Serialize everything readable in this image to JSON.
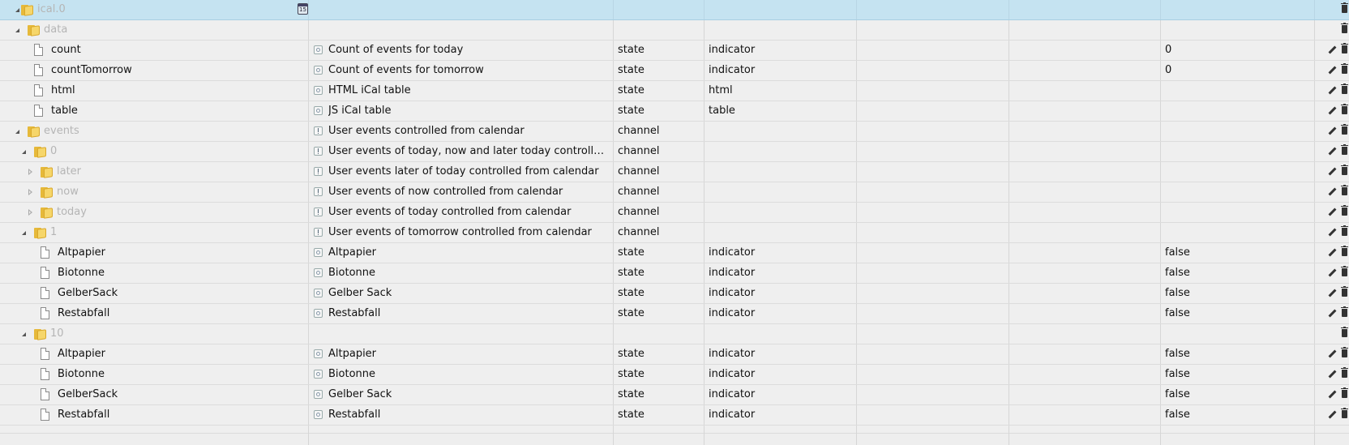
{
  "rows": [
    {
      "name": "ical.0",
      "kind": "folder",
      "level": 0,
      "expanded": true,
      "selected": true,
      "adapter_icon": "calendar-icon",
      "role_text": "",
      "role_icon": "",
      "type": "",
      "role": "",
      "value": "",
      "actions": "delete"
    },
    {
      "name": "data",
      "kind": "folder",
      "level": 1,
      "expanded": true,
      "role_text": "",
      "role_icon": "",
      "type": "",
      "role": "",
      "value": "",
      "actions": "delete"
    },
    {
      "name": "count",
      "kind": "file",
      "level": 2,
      "role_text": "Count of events for today",
      "role_icon": "state",
      "type": "state",
      "role": "indicator",
      "value": "0",
      "actions": "edit-delete"
    },
    {
      "name": "countTomorrow",
      "kind": "file",
      "level": 2,
      "role_text": "Count of events for tomorrow",
      "role_icon": "state",
      "type": "state",
      "role": "indicator",
      "value": "0",
      "actions": "edit-delete"
    },
    {
      "name": "html",
      "kind": "file",
      "level": 2,
      "role_text": "HTML iCal table",
      "role_icon": "state",
      "type": "state",
      "role": "html",
      "value": "",
      "actions": "edit-delete"
    },
    {
      "name": "table",
      "kind": "file",
      "level": 2,
      "role_text": "JS iCal table",
      "role_icon": "state",
      "type": "state",
      "role": "table",
      "value": "",
      "actions": "edit-delete"
    },
    {
      "name": "events",
      "kind": "folder",
      "level": 1,
      "expanded": true,
      "role_text": "User events controlled from calendar",
      "role_icon": "channel",
      "type": "channel",
      "role": "",
      "value": "",
      "actions": "edit-delete"
    },
    {
      "name": "0",
      "kind": "folder",
      "level": 2,
      "expanded": true,
      "role_text": "User events of today, now and later today controlled fro...",
      "role_icon": "channel",
      "type": "channel",
      "role": "",
      "value": "",
      "actions": "edit-delete"
    },
    {
      "name": "later",
      "kind": "folder",
      "level": 3,
      "expanded": false,
      "role_text": "User events later of today controlled from calendar",
      "role_icon": "channel",
      "type": "channel",
      "role": "",
      "value": "",
      "actions": "edit-delete"
    },
    {
      "name": "now",
      "kind": "folder",
      "level": 3,
      "expanded": false,
      "role_text": "User events of now controlled from calendar",
      "role_icon": "channel",
      "type": "channel",
      "role": "",
      "value": "",
      "actions": "edit-delete"
    },
    {
      "name": "today",
      "kind": "folder",
      "level": 3,
      "expanded": false,
      "role_text": "User events of today controlled from calendar",
      "role_icon": "channel",
      "type": "channel",
      "role": "",
      "value": "",
      "actions": "edit-delete"
    },
    {
      "name": "1",
      "kind": "folder",
      "level": 2,
      "expanded": true,
      "role_text": "User events of tomorrow controlled from calendar",
      "role_icon": "channel",
      "type": "channel",
      "role": "",
      "value": "",
      "actions": "edit-delete"
    },
    {
      "name": "Altpapier",
      "kind": "file",
      "level": 3,
      "role_text": "Altpapier",
      "role_icon": "state",
      "type": "state",
      "role": "indicator",
      "value": "false",
      "actions": "edit-delete"
    },
    {
      "name": "Biotonne",
      "kind": "file",
      "level": 3,
      "role_text": "Biotonne",
      "role_icon": "state",
      "type": "state",
      "role": "indicator",
      "value": "false",
      "actions": "edit-delete"
    },
    {
      "name": "GelberSack",
      "kind": "file",
      "level": 3,
      "role_text": "Gelber Sack",
      "role_icon": "state",
      "type": "state",
      "role": "indicator",
      "value": "false",
      "actions": "edit-delete"
    },
    {
      "name": "Restabfall",
      "kind": "file",
      "level": 3,
      "role_text": "Restabfall",
      "role_icon": "state",
      "type": "state",
      "role": "indicator",
      "value": "false",
      "actions": "edit-delete"
    },
    {
      "name": "10",
      "kind": "folder",
      "level": 2,
      "expanded": true,
      "role_text": "",
      "role_icon": "",
      "type": "",
      "role": "",
      "value": "",
      "actions": "delete"
    },
    {
      "name": "Altpapier",
      "kind": "file",
      "level": 3,
      "role_text": "Altpapier",
      "role_icon": "state",
      "type": "state",
      "role": "indicator",
      "value": "false",
      "actions": "edit-delete"
    },
    {
      "name": "Biotonne",
      "kind": "file",
      "level": 3,
      "role_text": "Biotonne",
      "role_icon": "state",
      "type": "state",
      "role": "indicator",
      "value": "false",
      "actions": "edit-delete"
    },
    {
      "name": "GelberSack",
      "kind": "file",
      "level": 3,
      "role_text": "Gelber Sack",
      "role_icon": "state",
      "type": "state",
      "role": "indicator",
      "value": "false",
      "actions": "edit-delete"
    },
    {
      "name": "Restabfall",
      "kind": "file",
      "level": 3,
      "role_text": "Restabfall",
      "role_icon": "state",
      "type": "state",
      "role": "indicator",
      "value": "false",
      "actions": "edit-delete"
    }
  ],
  "colors": {
    "selected_row": "#c5e3f1",
    "row": "#efefef",
    "folder": "#f6d66a",
    "folder_label": "#b5b5b5"
  }
}
